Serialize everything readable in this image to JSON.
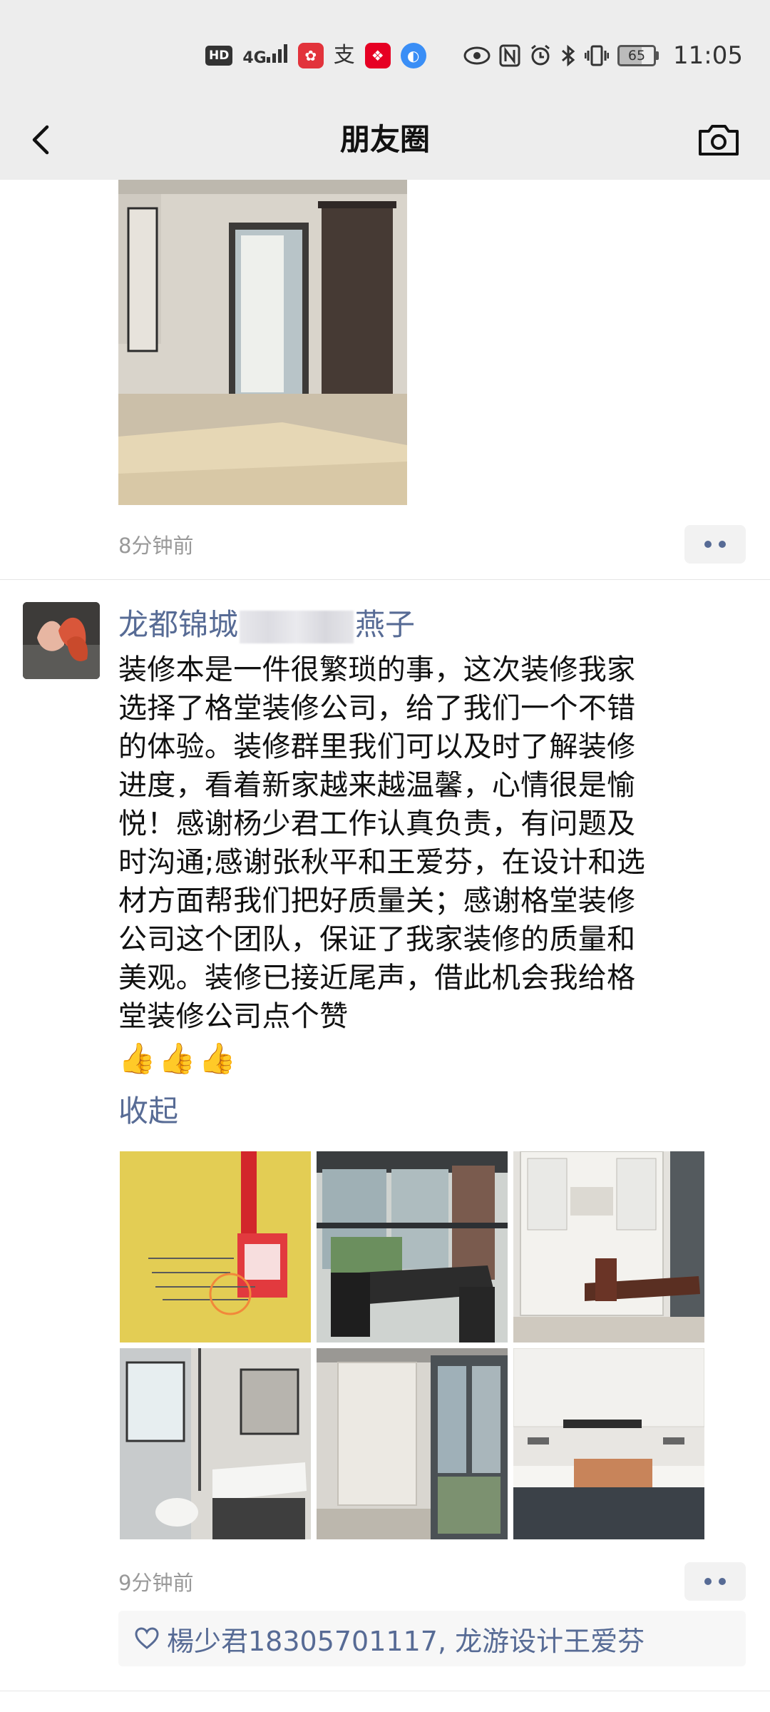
{
  "status_bar": {
    "hd_label": "HD",
    "signal": "4G",
    "alipay_glyph": "支",
    "battery": "65",
    "time": "11:05"
  },
  "nav": {
    "title": "朋友圈",
    "back_icon": "chevron-left-icon",
    "camera_icon": "camera-icon"
  },
  "posts": [
    {
      "time": "8分钟前",
      "photos": [
        "bedroom-photo"
      ]
    },
    {
      "author": {
        "name_prefix": "龙都锦城",
        "name_suffix": "燕子"
      },
      "text_lines": [
        "装修本是一件很繁琐的事，这次装修我家",
        "选择了格堂装修公司，给了我们一个不错",
        "的体验。装修群里我们可以及时了解装修",
        "进度，看着新家越来越温馨，心情很是愉",
        "悦！感谢杨少君工作认真负责，有问题及",
        "时沟通;感谢张秋平和王爱芬，在设计和选",
        "材方面帮我们把好质量关；感谢格堂装修",
        "公司这个团队，保证了我家装修的质量和",
        "美观。装修已接近尾声，借此机会我给格",
        "堂装修公司点个赞"
      ],
      "emoji": "👍👍👍",
      "collapse_label": "收起",
      "photos": [
        "yellow-doc-photo",
        "dining-room-photo",
        "cabinet-room-photo",
        "bathroom-photo",
        "balcony-photo",
        "kitchen-photo"
      ],
      "time": "9分钟前",
      "likes": "楊少君18305701117, 龙游设计王爱芬"
    }
  ],
  "colors": {
    "link": "#576b95",
    "header_bg": "#ededed",
    "secondary_text": "#999999"
  }
}
